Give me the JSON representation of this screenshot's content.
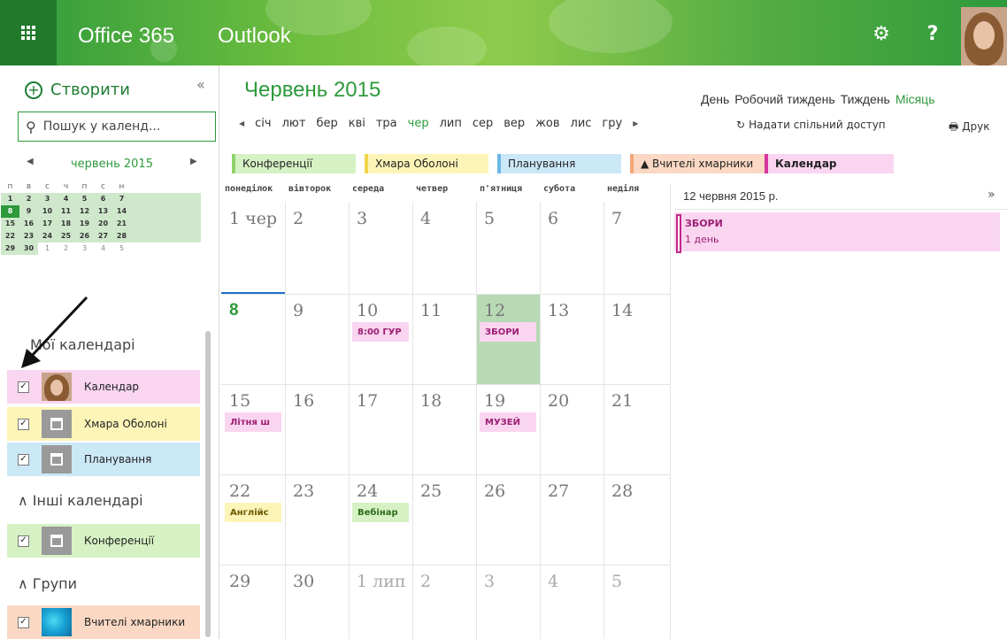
{
  "topbar": {
    "brand": "Office 365",
    "app": "Outlook",
    "settings_icon": "gear-icon",
    "help_label": "?"
  },
  "sidebar": {
    "create_label": "Створити",
    "collapse_label": "«",
    "search_placeholder": "Пошук у календ...",
    "mini_month": "червень 2015",
    "weekday_heads": [
      "п",
      "в",
      "с",
      "ч",
      "п",
      "с",
      "н"
    ],
    "mini_weeks": [
      [
        "1",
        "2",
        "3",
        "4",
        "5",
        "6",
        "7"
      ],
      [
        "8",
        "9",
        "10",
        "11",
        "12",
        "13",
        "14"
      ],
      [
        "15",
        "16",
        "17",
        "18",
        "19",
        "20",
        "21"
      ],
      [
        "22",
        "23",
        "24",
        "25",
        "26",
        "27",
        "28"
      ],
      [
        "29",
        "30",
        "1",
        "2",
        "3",
        "4",
        "5"
      ]
    ],
    "my_calendars": "Мої календарі",
    "other_calendars": "Інші календарі",
    "groups": "Групи",
    "calendars": [
      {
        "label": "Календар",
        "color": "#fad5f0"
      },
      {
        "label": "Хмара Оболоні",
        "color": "#fdf4b8"
      },
      {
        "label": "Планування",
        "color": "#cbe8f7"
      },
      {
        "label": "Конференції",
        "color": "#d6f2c4"
      },
      {
        "label": "Вчителі хмарники",
        "color": "#fad8c3"
      }
    ]
  },
  "main": {
    "title": "Червень 2015",
    "views": [
      "День",
      "Робочий тиждень",
      "Тиждень",
      "Місяць"
    ],
    "months": [
      "січ",
      "лют",
      "бер",
      "кві",
      "тра",
      "чер",
      "лип",
      "сер",
      "вер",
      "жов",
      "лис",
      "гру"
    ],
    "share": "Надати спільний доступ",
    "print": "Друк",
    "chips": [
      {
        "label": "Конференції",
        "color": "#d6f2c4",
        "border": "#8fd36a"
      },
      {
        "label": "Хмара Оболоні",
        "color": "#fdf4b8",
        "border": "#f0d64a"
      },
      {
        "label": "Планування",
        "color": "#cbe8f7",
        "border": "#6ab8e6"
      },
      {
        "label": "▲ Вчителі хмарники",
        "color": "#fad8c3",
        "border": "#f2a679"
      },
      {
        "label": "Календар",
        "color": "#fad5f0",
        "border": "#d4359e"
      }
    ],
    "day_heads": [
      "понеділок",
      "вівторок",
      "середа",
      "четвер",
      "п'ятниця",
      "субота",
      "неділя"
    ],
    "weeks": [
      [
        "1 чер",
        "2",
        "3",
        "4",
        "5",
        "6",
        "7"
      ],
      [
        "8",
        "9",
        "10",
        "11",
        "12",
        "13",
        "14"
      ],
      [
        "15",
        "16",
        "17",
        "18",
        "19",
        "20",
        "21"
      ],
      [
        "22",
        "23",
        "24",
        "25",
        "26",
        "27",
        "28"
      ],
      [
        "29",
        "30",
        "1 лип",
        "2",
        "3",
        "4",
        "5"
      ]
    ],
    "events": {
      "e10": "8:00 ГУР",
      "e12": "ЗБОРИ",
      "e15": "Літня ш",
      "e19": "МУЗЕЙ",
      "e22": "Англійс",
      "e24": "Вебінар"
    }
  },
  "rightpane": {
    "date": "12 червня 2015 р.",
    "more": "»",
    "event_title": "ЗБОРИ",
    "event_duration": "1 день"
  }
}
